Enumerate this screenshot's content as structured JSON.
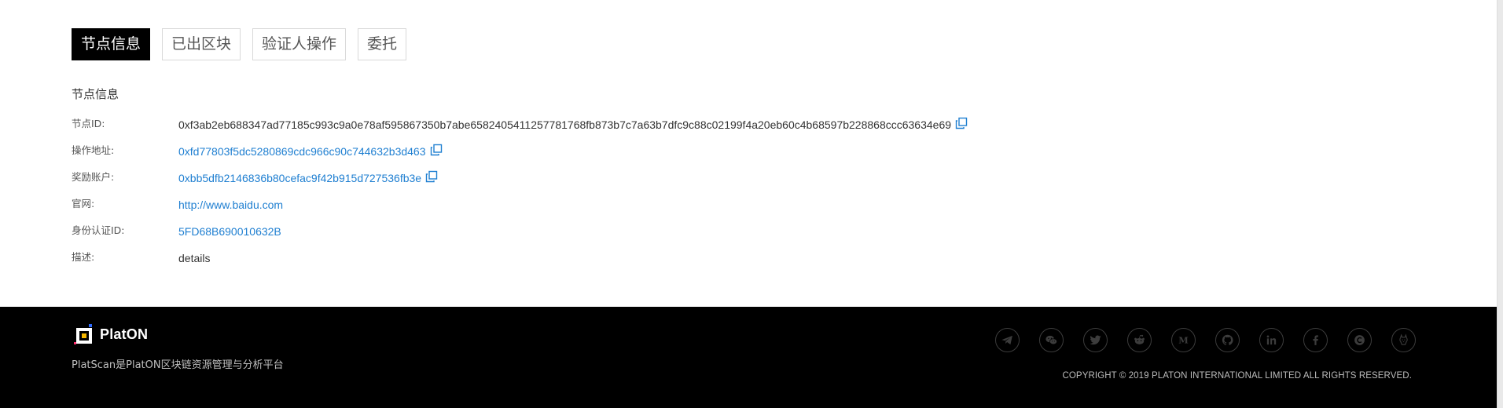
{
  "tabs": [
    {
      "label": "节点信息",
      "active": true
    },
    {
      "label": "已出区块",
      "active": false
    },
    {
      "label": "验证人操作",
      "active": false
    },
    {
      "label": "委托",
      "active": false
    }
  ],
  "section_title": "节点信息",
  "rows": [
    {
      "label": "节点ID:",
      "value": "0xf3ab2eb688347ad77185c993c9a0e78af595867350b7abe6582405411257781768fb873b7c7a63b7dfc9c88c02199f4a20eb60c4b68597b228868ccc63634e69",
      "type": "text",
      "copyable": true
    },
    {
      "label": "操作地址:",
      "value": "0xfd77803f5dc5280869cdc966c90c744632b3d463",
      "type": "link",
      "copyable": true
    },
    {
      "label": "奖励账户:",
      "value": "0xbb5dfb2146836b80cefac9f42b915d727536fb3e",
      "type": "link",
      "copyable": true
    },
    {
      "label": "官网:",
      "value": "http://www.baidu.com",
      "type": "link",
      "copyable": false
    },
    {
      "label": "身份认证ID:",
      "value": "5FD68B690010632B",
      "type": "link",
      "copyable": false
    },
    {
      "label": "描述:",
      "value": "details",
      "type": "text",
      "copyable": false
    }
  ],
  "footer": {
    "logo_text": "PlatON",
    "tagline": "PlatScan是PlatON区块链资源管理与分析平台",
    "copyright": "COPYRIGHT © 2019 PLATON INTERNATIONAL LIMITED ALL RIGHTS RESERVED.",
    "socials": [
      "telegram-icon",
      "wechat-icon",
      "twitter-icon",
      "reddit-icon",
      "medium-icon",
      "github-icon",
      "linkedin-icon",
      "facebook-icon",
      "coinmarketcap-icon",
      "alpaca-icon"
    ]
  },
  "colors": {
    "link": "#1f7fd1",
    "footer_bg": "#000000",
    "active_tab_bg": "#000000",
    "logo_accent": "#f5b700"
  }
}
